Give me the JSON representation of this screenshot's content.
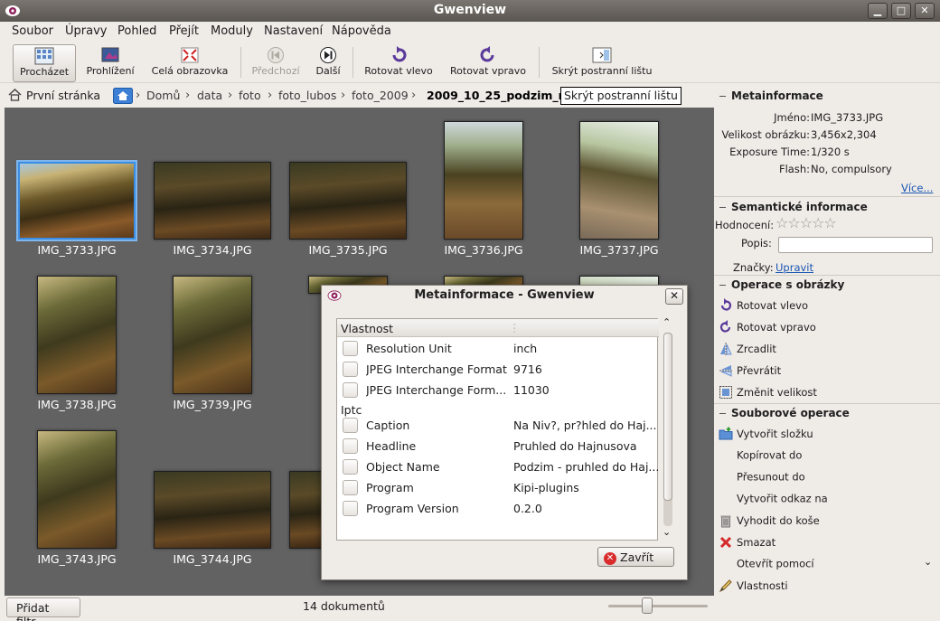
{
  "window": {
    "title": "Gwenview"
  },
  "menu": [
    "Soubor",
    "Úpravy",
    "Pohled",
    "Přejít",
    "Moduly",
    "Nastavení",
    "Nápověda"
  ],
  "toolbar": {
    "browse": "Procházet",
    "view": "Prohlížení",
    "fullscreen": "Celá obrazovka",
    "previous": "Předchozí",
    "next": "Další",
    "rotate_left": "Rotovat vlevo",
    "rotate_right": "Rotovat vpravo",
    "hide_sidebar": "Skrýt postranní lištu"
  },
  "breadcrumb": {
    "start": "První stránka",
    "parts": [
      "Domů",
      "data",
      "foto",
      "foto_lubos",
      "foto_2009"
    ],
    "current": "2009_10_25_podzim_n",
    "tooltip": "Skrýt postranní lištu"
  },
  "thumbnails": [
    "IMG_3733.JPG",
    "IMG_3734.JPG",
    "IMG_3735.JPG",
    "IMG_3736.JPG",
    "IMG_3737.JPG",
    "IMG_3738.JPG",
    "IMG_3739.JPG",
    "IMG_3743.JPG",
    "IMG_3744.JPG"
  ],
  "status": {
    "filter": "Přidat filtr",
    "count": "14 dokumentů"
  },
  "sidebar": {
    "meta_title": "Metainformace",
    "meta": [
      {
        "key": "Jméno:",
        "value": "IMG_3733.JPG"
      },
      {
        "key": "Velikost obrázku:",
        "value": "3,456x2,304"
      },
      {
        "key": "Exposure Time:",
        "value": "1/320 s"
      },
      {
        "key": "Flash:",
        "value": "No, compulsory"
      }
    ],
    "more": "Více...",
    "semantic_title": "Semantické informace",
    "rating_label": "Hodnocení:",
    "desc_label": "Popis:",
    "tags_label": "Značky:",
    "tags_edit": "Upravit",
    "image_ops_title": "Operace s obrázky",
    "image_ops": [
      "Rotovat vlevo",
      "Rotovat vpravo",
      "Zrcadlit",
      "Převrátit",
      "Změnit velikost"
    ],
    "file_ops_title": "Souborové operace",
    "file_ops": [
      "Vytvořit složku",
      "Kopírovat do",
      "Přesunout do",
      "Vytvořit odkaz na",
      "Vyhodit do koše",
      "Smazat",
      "Otevřít pomocí",
      "Vlastnosti"
    ]
  },
  "dialog": {
    "title": "Metainformace - Gwenview",
    "column": "Vlastnost",
    "rows": [
      {
        "key": "Resolution Unit",
        "value": "inch"
      },
      {
        "key": "JPEG Interchange Format",
        "value": "9716"
      },
      {
        "key": "JPEG Interchange Form...",
        "value": "11030"
      }
    ],
    "group": "Iptc",
    "iptc_rows": [
      {
        "key": "Caption",
        "value": "Na Niv?, pr?hled do Haj..."
      },
      {
        "key": "Headline",
        "value": "Pruhled do Hajnusova"
      },
      {
        "key": "Object Name",
        "value": "Podzim - pruhled do Haj..."
      },
      {
        "key": "Program",
        "value": "Kipi-plugins"
      },
      {
        "key": "Program Version",
        "value": "0.2.0"
      }
    ],
    "close": "Zavřít"
  }
}
